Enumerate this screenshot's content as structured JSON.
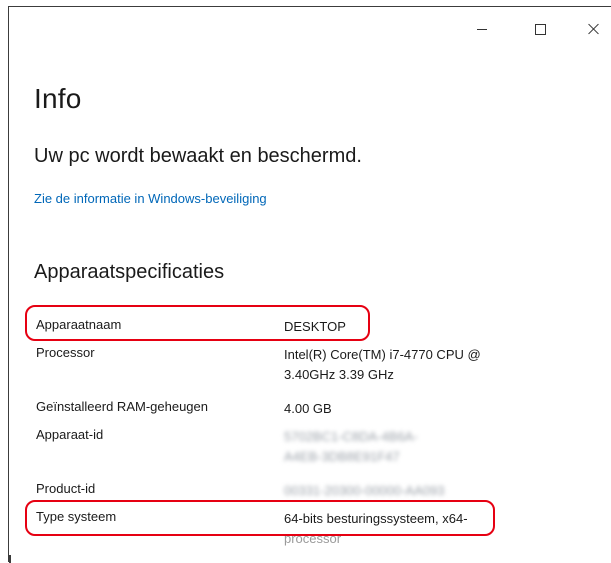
{
  "window": {
    "controls": {
      "minimize_icon": "minimize-icon",
      "maximize_icon": "maximize-icon",
      "close_icon": "close-icon"
    }
  },
  "page": {
    "title": "Info",
    "protection_status": "Uw pc wordt bewaakt en beschermd.",
    "security_link": "Zie de informatie in Windows-beveiliging"
  },
  "specs": {
    "heading": "Apparaatspecificaties",
    "rows": [
      {
        "label": "Apparaatnaam",
        "value": "DESKTOP"
      },
      {
        "label": "Processor",
        "value_line1": "Intel(R) Core(TM) i7-4770 CPU @",
        "value_line2": "3.40GHz   3.39 GHz"
      },
      {
        "label": "Geïnstalleerd RAM-geheugen",
        "value": "4.00 GB"
      },
      {
        "label": "Apparaat-id",
        "value_line1": "5702BC1-C8DA-4B6A-",
        "value_line2": "A4EB-3DB8E91F47"
      },
      {
        "label": "Product-id",
        "value": "00331-20300-00000-AA093"
      },
      {
        "label": "Type systeem",
        "value_line1": "64-bits besturingssysteem, x64-",
        "value_line2": "processor"
      }
    ]
  },
  "colors": {
    "link": "#0067b8",
    "highlight": "#e60012",
    "text": "#1a1a1a"
  }
}
